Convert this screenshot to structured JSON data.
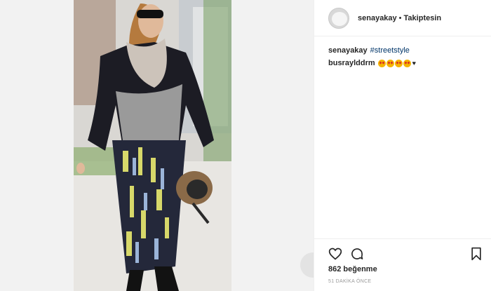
{
  "post": {
    "username": "senayakay",
    "dot": "•",
    "follow_status": "Takiptesin",
    "caption_username": "senayakay",
    "caption_hashtag": "#streetstyle",
    "comment_username": "busraylddrm",
    "likes_text": "862 beğenme",
    "timestamp": "51 DAKİKA ÖNCE"
  },
  "icons": {
    "like": "heart-icon",
    "comment": "comment-icon",
    "save": "bookmark-icon"
  },
  "colors": {
    "hashtag": "#003569",
    "text": "#262626",
    "muted": "#999999"
  }
}
